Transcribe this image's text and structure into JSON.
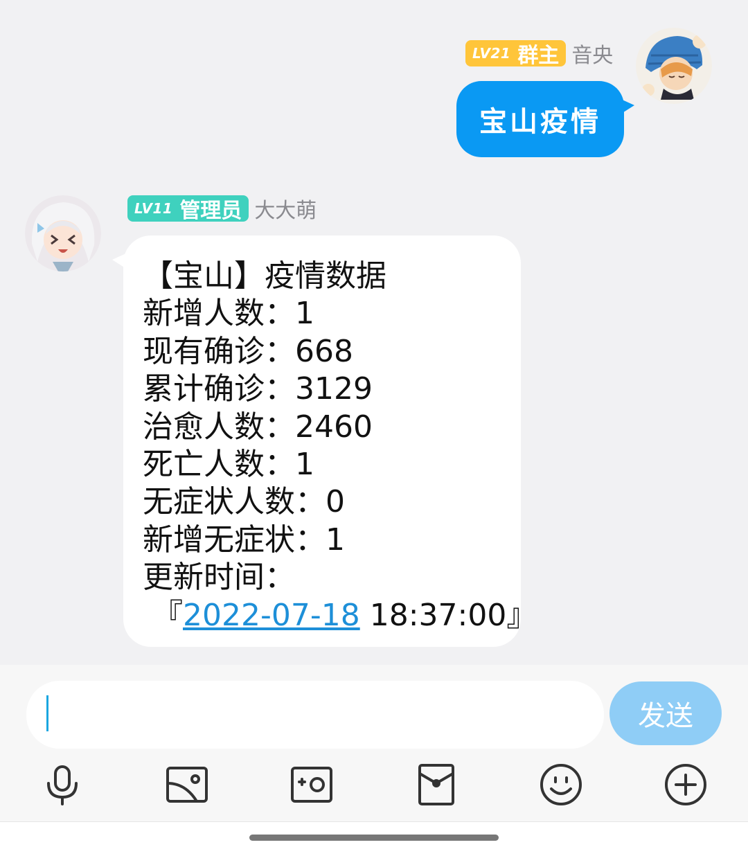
{
  "outgoing": {
    "level": "LV21",
    "role": "群主",
    "nickname": "音央",
    "text": "宝山疫情"
  },
  "incoming": {
    "level": "LV11",
    "role": "管理员",
    "nickname": "大大萌",
    "lines": [
      "【宝山】疫情数据",
      "新增人数：1",
      "现有确诊：668",
      "累计确诊：3129",
      "治愈人数：2460",
      "死亡人数：1",
      "无症状人数：0",
      "新增无症状：1",
      "更新时间："
    ],
    "time_prefix": " 『",
    "time_date": "2022-07-18",
    "time_rest": " 18:37:00』"
  },
  "composer": {
    "input_value": "",
    "send_label": "发送"
  },
  "toolbar": {
    "icons": [
      "microphone-icon",
      "photo-icon",
      "camera-icon",
      "red-packet-icon",
      "emoji-icon",
      "plus-icon"
    ]
  },
  "colors": {
    "outgoing_bubble": "#0a99f3",
    "owner_badge": "#ffc53a",
    "admin_badge": "#3fd1be",
    "send_button": "#8fcdf6",
    "link": "#1d8fd8"
  }
}
